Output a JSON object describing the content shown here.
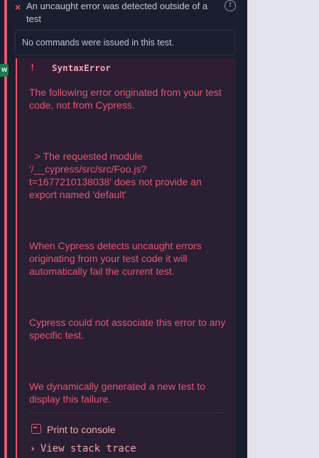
{
  "test": {
    "status_icon": "×",
    "title": "An uncaught error was detected outside of a test",
    "info_icon": "!"
  },
  "side_badge": "w",
  "no_commands": "No commands were issued in this test.",
  "error": {
    "bang": "!",
    "name": "SyntaxError",
    "messages": [
      "The following error originated from your test code, not from Cypress.",
      "  > The requested module '/__cypress/src/src/Foo.js?t=1677210138038' does not provide an export named 'default'",
      "When Cypress detects uncaught errors originating from your test code it will automatically fail the current test.",
      "Cypress could not associate this error to any specific test.",
      "We dynamically generated a new test to display this failure."
    ],
    "print_to_console": "Print to console",
    "stack_chevron": "›",
    "view_stack_trace": "View stack trace"
  },
  "colors": {
    "error_red": "#e45770",
    "reporter_bg": "#1b1e2e",
    "error_panel_bg": "#2a1f33",
    "app_bg": "#e2e3ec"
  }
}
